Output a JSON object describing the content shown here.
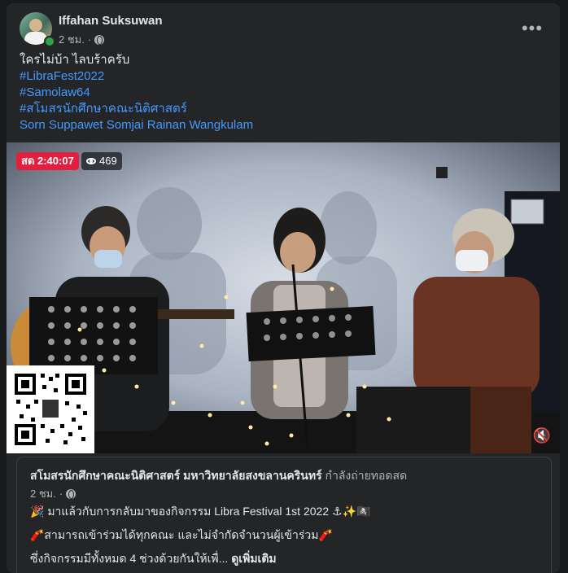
{
  "post": {
    "author": "Iffahan Suksuwan",
    "time": "2 ชม.",
    "separator": "·",
    "more_label": "•••",
    "text_line": "ใครไม่บ้า ไลบร้าครับ",
    "hashtags": [
      "#LibraFest2022",
      "#Samolaw64",
      "#สโมสรนักศึกษาคณะนิติศาสตร์"
    ],
    "tags": "Sorn Suppawet Somjai Rainan Wangkulam"
  },
  "video": {
    "live_label": "สด 2:40:07",
    "viewer_count": "469",
    "mute_icon": "speaker-muted-icon"
  },
  "shared": {
    "page_name": "สโมสรนักศึกษาคณะนิติศาสตร์ มหาวิทยาลัยสงขลานครินทร์",
    "action": "กำลังถ่ายทอดสด",
    "time": "2 ชม.",
    "line1": "🎉 มาแล้วกับการกลับมาของกิจกรรม Libra Festival 1st 2022 ⚓✨🏴‍☠️",
    "line2": "🧨สามารถเข้าร่วมได้ทุกคณะ และไม่จำกัดจำนวนผู้เข้าร่วม🧨",
    "line3": "ซึ่งกิจกรรมมีทั้งหมด 4 ช่วงด้วยกันให้เพื่...",
    "see_more": "ดูเพิ่มเติม"
  }
}
